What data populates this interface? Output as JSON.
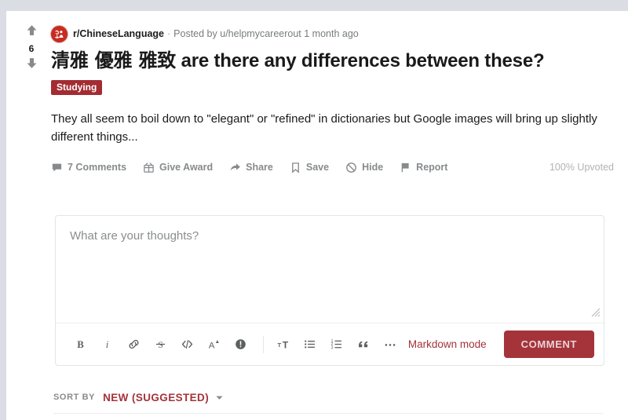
{
  "colors": {
    "page_background": "#dadde4",
    "card_background": "#ffffff",
    "brand_red": "#a4343a",
    "flair_background": "#a22c32",
    "subreddit_icon": "#c72c20",
    "muted_text": "#787c7e",
    "primary_text": "#1a1a1b"
  },
  "post": {
    "vote": {
      "upvote_icon": "arrow-up-icon",
      "score": "6",
      "downvote_icon": "arrow-down-icon"
    },
    "subreddit_icon": "subreddit-avatar-icon",
    "subreddit": "r/ChineseLanguage",
    "meta_separator": "·",
    "posted_by": "Posted by u/helpmycareerout 1 month ago",
    "title": "清雅 優雅 雅致 are there any differences between these?",
    "title_cjk": "清雅 優雅 雅致",
    "title_latin": "are there any differences between these?",
    "flair": "Studying",
    "body": "They all seem to boil down to \"elegant\" or \"refined\" in dictionaries but Google images will bring up slightly different things...",
    "upvoted_percent": "100% Upvoted"
  },
  "actions": [
    {
      "label": "7 Comments",
      "icon": "comment-bubble-icon"
    },
    {
      "label": "Give Award",
      "icon": "award-gift-icon"
    },
    {
      "label": "Share",
      "icon": "share-arrow-icon"
    },
    {
      "label": "Save",
      "icon": "bookmark-icon"
    },
    {
      "label": "Hide",
      "icon": "hide-circle-slash-icon"
    },
    {
      "label": "Report",
      "icon": "report-flag-icon"
    }
  ],
  "comment_editor": {
    "placeholder": "What are your thoughts?",
    "value": "",
    "resize_handle_icon": "resize-grip-icon",
    "toolbar": [
      {
        "icon": "bold-icon",
        "label": "B"
      },
      {
        "icon": "italic-icon",
        "label": "i"
      },
      {
        "icon": "link-icon",
        "label": "link"
      },
      {
        "icon": "strikethrough-icon",
        "label": "S"
      },
      {
        "icon": "inline-code-icon",
        "label": "</>"
      },
      {
        "icon": "superscript-icon",
        "label": "A"
      },
      {
        "icon": "spoiler-icon",
        "label": "!"
      },
      {
        "icon": "heading-icon",
        "label": "T"
      },
      {
        "icon": "bulleted-list-icon",
        "label": "list"
      },
      {
        "icon": "numbered-list-icon",
        "label": "numbered list"
      },
      {
        "icon": "blockquote-icon",
        "label": "quote"
      },
      {
        "icon": "more-options-icon",
        "label": "..."
      }
    ],
    "markdown_mode_label": "Markdown mode",
    "submit_label": "COMMENT"
  },
  "sort": {
    "label": "SORT BY",
    "value": "NEW (SUGGESTED)",
    "chevron_icon": "chevron-down-icon"
  }
}
